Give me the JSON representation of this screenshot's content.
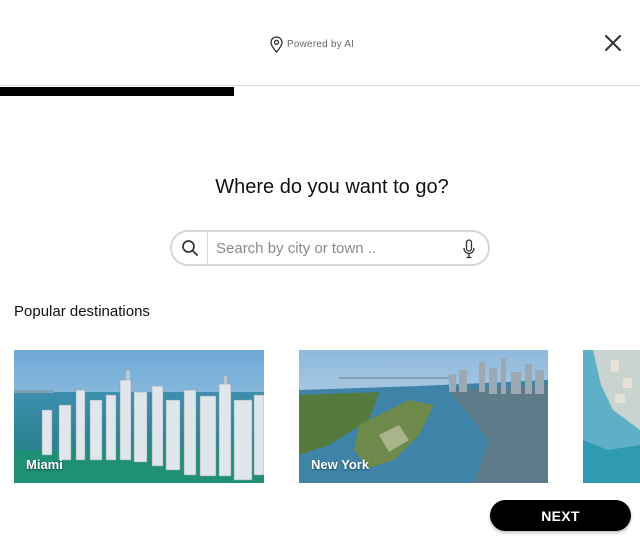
{
  "header": {
    "powered_by": "Powered by AI",
    "icon": "map-pin-icon",
    "close_icon": "close-icon"
  },
  "progress": {
    "fraction": 0.366
  },
  "question": "Where do you want to go?",
  "search": {
    "placeholder": "Search by city or town ..",
    "value": "",
    "icons": [
      "search-icon",
      "microphone-icon"
    ]
  },
  "popular": {
    "title": "Popular destinations",
    "cards": [
      {
        "label": "Miami"
      },
      {
        "label": "New York"
      },
      {
        "label": ""
      }
    ]
  },
  "actions": {
    "next_label": "NEXT"
  },
  "colors": {
    "primary": "#000000",
    "border": "#d6d6d6",
    "muted": "#6b6b6b"
  }
}
